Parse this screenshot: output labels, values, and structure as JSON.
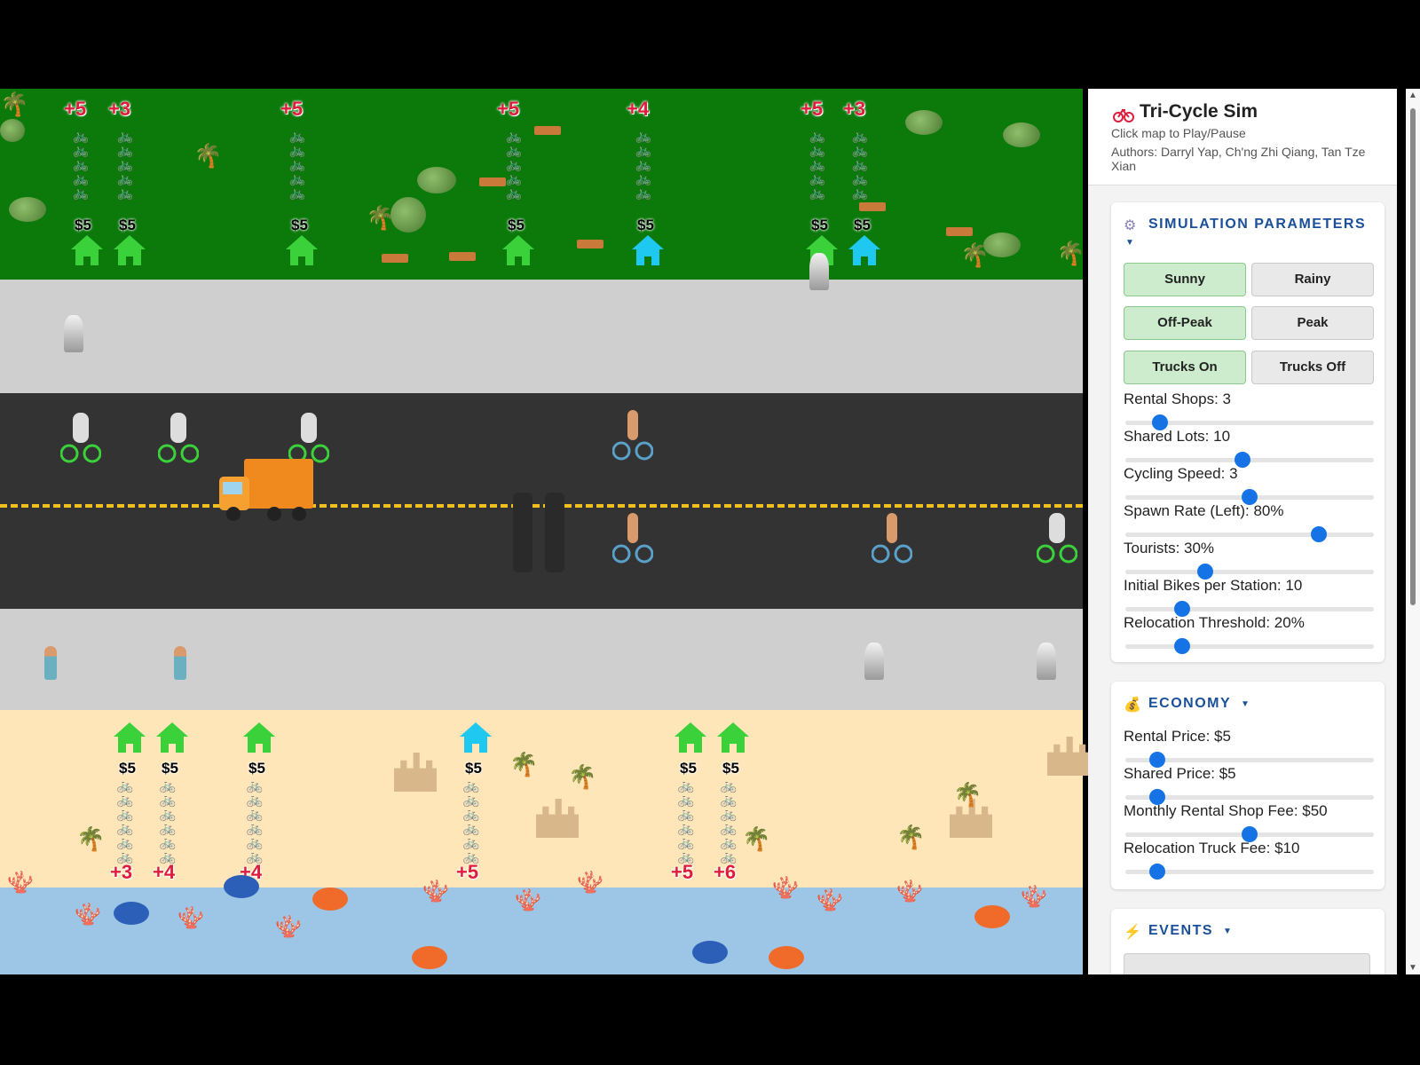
{
  "app": {
    "title": "Tri-Cycle Sim",
    "hint": "Click map to Play/Pause",
    "authors": "Authors: Darryl Yap, Ch'ng Zhi Qiang, Tan Tze Xian"
  },
  "map": {
    "park_stations": [
      {
        "label": "+5",
        "price": "$5",
        "color": "#3bd13b"
      },
      {
        "label": "+3",
        "price": "$5",
        "color": "#3bd13b"
      },
      {
        "label": "+5",
        "price": "$5",
        "color": "#3bd13b"
      },
      {
        "label": "+5",
        "price": "$5",
        "color": "#3bd13b"
      },
      {
        "label": "+4",
        "price": "$5",
        "color": "#1ec8f0"
      },
      {
        "label": "+5",
        "price": "$5",
        "color": "#3bd13b"
      },
      {
        "label": "+3",
        "price": "$5",
        "color": "#1ec8f0"
      }
    ],
    "beach_stations": [
      {
        "label": "+3",
        "price": "$5",
        "color": "#3bd13b"
      },
      {
        "label": "+4",
        "price": "$5",
        "color": "#3bd13b"
      },
      {
        "label": "+4",
        "price": "$5",
        "color": "#3bd13b"
      },
      {
        "label": "+5",
        "price": "$5",
        "color": "#1ec8f0"
      },
      {
        "label": "+5",
        "price": "$5",
        "color": "#3bd13b"
      },
      {
        "label": "+6",
        "price": "$5",
        "color": "#3bd13b"
      }
    ],
    "icons": [
      "house-icon",
      "bike-icon",
      "truck-icon",
      "merlion-icon",
      "palm-icon",
      "tree-icon",
      "bench-icon",
      "coral-icon",
      "fish-icon",
      "pause-icon"
    ],
    "colors": {
      "park": "#0b7a0b",
      "sidewalk": "#cfcfcf",
      "road": "#333333",
      "lane": "#f0c020",
      "beach": "#ffe6b8",
      "sea": "#9dc6e6"
    }
  },
  "sim_params": {
    "heading": "SIMULATION PARAMETERS",
    "icon": "gear-icon",
    "toggles": [
      {
        "label": "Sunny",
        "active": true
      },
      {
        "label": "Rainy",
        "active": false
      },
      {
        "label": "Off-Peak",
        "active": true
      },
      {
        "label": "Peak",
        "active": false
      },
      {
        "label": "Trucks On",
        "active": true
      },
      {
        "label": "Trucks Off",
        "active": false
      }
    ],
    "sliders": [
      {
        "label": "Rental Shops: 3",
        "fraction": 0.14
      },
      {
        "label": "Shared Lots: 10",
        "fraction": 0.47
      },
      {
        "label": "Cycling Speed: 3",
        "fraction": 0.5
      },
      {
        "label": "Spawn Rate (Left): 80%",
        "fraction": 0.78
      },
      {
        "label": "Tourists: 30%",
        "fraction": 0.32
      },
      {
        "label": "Initial Bikes per Station: 10",
        "fraction": 0.23
      },
      {
        "label": "Relocation Threshold: 20%",
        "fraction": 0.23
      }
    ]
  },
  "economy": {
    "heading": "ECONOMY",
    "icon": "money-bag-icon",
    "sliders": [
      {
        "label": "Rental Price: $5",
        "fraction": 0.13
      },
      {
        "label": "Shared Price: $5",
        "fraction": 0.13
      },
      {
        "label": "Monthly Rental Shop Fee: $50",
        "fraction": 0.5
      },
      {
        "label": "Relocation Truck Fee: $10",
        "fraction": 0.13
      }
    ]
  },
  "events": {
    "heading": "EVENTS",
    "icon": "lightning-icon"
  },
  "accent": "#1673e6"
}
